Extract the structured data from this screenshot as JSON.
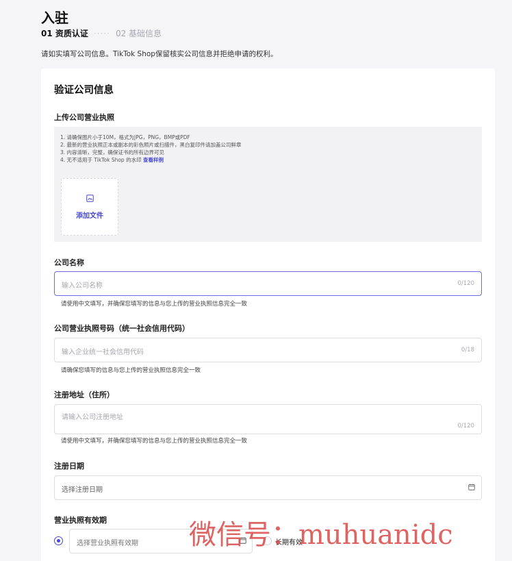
{
  "page": {
    "title": "入驻"
  },
  "steps": {
    "step1": "01 资质认证",
    "separator": "·····",
    "step2": "02 基础信息"
  },
  "notice": "请如实填写公司信息。TikTok Shop保留核实公司信息并拒绝申请的权利。",
  "card": {
    "title": "验证公司信息",
    "license_upload": {
      "label": "上传公司营业执照",
      "rules": [
        "1. 请确保图片小于10M，格式为JPG，PNG，BMP或PDF",
        "2. 最新的营业执照正本或副本的彩色照片或扫描件，黑白复印件请加盖公司鲜章",
        "3. 内容清晰，完整，确保证书的所有边界可见",
        "4. 无不适用于 TikTok Shop 的水印"
      ],
      "example_link": "查看样例",
      "add_file": "添加文件"
    },
    "company_name": {
      "label": "公司名称",
      "placeholder": "输入公司名称",
      "counter": "0/120",
      "hint": "请使用中文填写，并确保您填写的信息与您上传的营业执照信息完全一致"
    },
    "license_number": {
      "label": "公司营业执照号码（统一社会信用代码）",
      "placeholder": "输入企业统一社会信用代码",
      "counter": "0/18",
      "hint": "请确保您填写的信息与您上传的营业执照信息完全一致"
    },
    "address": {
      "label": "注册地址（住所）",
      "placeholder": "请输入公司注册地址",
      "counter": "0/120",
      "hint": "请使用中文填写，并确保您填写的信息与您上传的营业执照信息完全一致"
    },
    "reg_date": {
      "label": "注册日期",
      "placeholder": "选择注册日期"
    },
    "validity": {
      "label": "营业执照有效期",
      "placeholder": "选择营业执照有效期",
      "long_term": "长期有效"
    }
  },
  "watermark": "微信号：muhuanidc",
  "icons": {
    "image": "image-icon",
    "calendar": "calendar-icon"
  },
  "colors": {
    "accent": "#4747d6",
    "watermark": "#d94a4a"
  }
}
